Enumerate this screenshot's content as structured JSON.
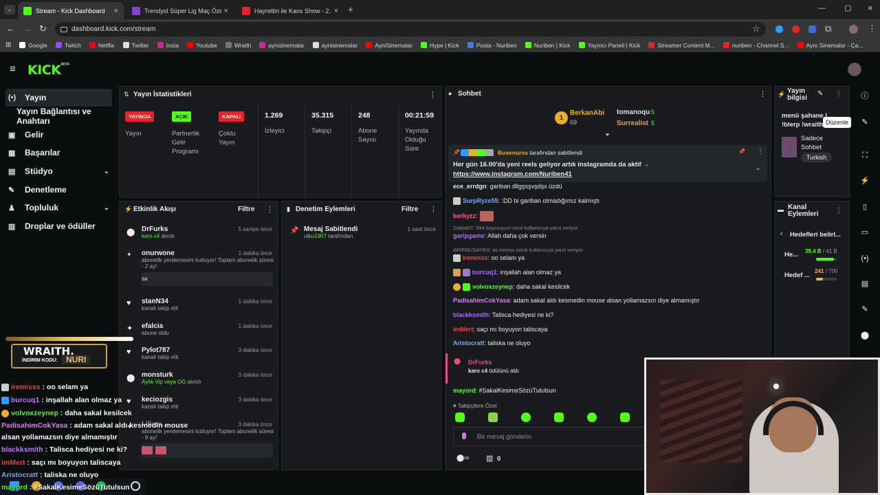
{
  "colors": {
    "kick_green": "#53fc18",
    "panel_bg": "#191b1f",
    "page_bg": "#0b0e0f",
    "red_badge": "#e4262c",
    "purple": "#b26bff"
  },
  "browser": {
    "tabs": [
      {
        "title": "Stream - Kick Dashboard",
        "icon": "kick-icon"
      },
      {
        "title": "Trendyol Süper Lig Maç Özetleri",
        "icon": "youtube-icon"
      },
      {
        "title": "Hayrettin ile Kaos Show - 2.Sez...",
        "icon": "youtube-icon"
      }
    ],
    "url": "dashboard.kick.com/stream",
    "bookmarks": [
      "Google",
      "Twitch",
      "Netflix",
      "Twitter",
      "Insta",
      "Youtube",
      "Wraith",
      "aynisinemalar",
      "aynisinemalar",
      "AyniSinemalar",
      "Hype | Kick",
      "Posta - Nuriben",
      "Nuriben | Kick",
      "Yayıncı Paneli | Kick",
      "Streamer Content M...",
      "nuriben - Channel S...",
      "Aynı Sinemalar - Ça..."
    ]
  },
  "logo": {
    "text": "KICK",
    "sup": "BETA"
  },
  "sidebar": {
    "items": [
      {
        "label": "Yayın",
        "icon": "broadcast-icon"
      },
      {
        "label": "Yayın Bağlantısı ve Anahtarı",
        "icon": ""
      },
      {
        "label": "Gelir",
        "icon": "dollar-icon"
      },
      {
        "label": "Başarılar",
        "icon": "trophy-icon"
      },
      {
        "label": "Stüdyo",
        "icon": "studio-icon"
      },
      {
        "label": "Denetleme",
        "icon": "wrench-icon"
      },
      {
        "label": "Topluluk",
        "icon": "users-icon"
      },
      {
        "label": "Droplar ve ödüller",
        "icon": "gift-icon"
      }
    ]
  },
  "stats": {
    "title": "Yayın İstatistikleri",
    "badges": [
      {
        "badge": "YAYINDA",
        "label": "Yayın"
      },
      {
        "badge": "AÇIK",
        "label": "Partnerlik Gelir Programı"
      },
      {
        "badge": "KAPALI",
        "label": "Çoklu Yayın"
      }
    ],
    "values": [
      {
        "value": "1.269",
        "label": "İzleyici"
      },
      {
        "value": "35.315",
        "label": "Takipçi"
      },
      {
        "value": "248",
        "label": "Abone Sayısı"
      },
      {
        "value": "00:21:59",
        "label": "Yayında Olduğu Süre"
      }
    ]
  },
  "activity": {
    "title": "Etkinlik Akışı",
    "filter": "Filtre",
    "events": [
      {
        "name": "DrFurks",
        "sub": "karo c4",
        "sub_suffix": " alındı",
        "time": "5 saniye önce",
        "icon": "drop-icon"
      },
      {
        "name": "onurwone",
        "sub": "abonelik yenilemesini kutluyor! Toplam abonelik süresi - 2 ay!",
        "time": "1 dakika önce",
        "message": "sa",
        "icon": "star-icon"
      },
      {
        "name": "stanN34",
        "sub": "kanalı takip etti",
        "time": "1 dakika önce",
        "icon": "heart-icon"
      },
      {
        "name": "efalcia",
        "sub": "abone oldu",
        "time": "1 dakika önce",
        "icon": "star-icon"
      },
      {
        "name": "Pylot787",
        "sub": "kanalı takip etti",
        "time": "3 dakika önce",
        "icon": "heart-icon"
      },
      {
        "name": "monsturk",
        "sub": "Aylık Vip veya OG",
        "sub_suffix": " alındı",
        "time": "3 dakika önce",
        "icon": "drop-icon"
      },
      {
        "name": "keciozgis",
        "sub": "kanalı takip etti",
        "time": "3 dakika önce",
        "icon": "heart-icon"
      },
      {
        "name": "Lilium...",
        "sub": "abonelik yenilemesini kutluyor! Toplam abonelik süresi - 9 ay!",
        "time": "3 dakika önce",
        "icon": "star-icon"
      }
    ]
  },
  "moderation": {
    "title": "Denetim Eylemleri",
    "filter": "Filtre",
    "event": {
      "name": "Mesaj Sabitlendi",
      "by": "utku1907",
      "by_suffix": " tarafından",
      "time": "1 saat önce"
    }
  },
  "chat": {
    "title": "Sohbet",
    "top_chatters": [
      {
        "name": "BerkanAbi",
        "count": "69"
      },
      {
        "name": "tomanoqu",
        "count": "5"
      },
      {
        "name": "Surrealist",
        "count": "5"
      }
    ],
    "pinned": {
      "by": "Busenurss",
      "by_suffix": " tarafından sabitlendi",
      "text": "Her gün 16.00'da yeni reels geliyor artık instagramda da aktif →",
      "link": "https://www.instagram.com/Nuriben41"
    },
    "messages": [
      {
        "user": "ece_errdgn",
        "color": "#e0e0e0",
        "text": ": gariban dllgşsşvşdşx üzdü"
      },
      {
        "user": "SurpRyze55",
        "color": "#7aa7ff",
        "text": ": :DD bi gariban olmadığımız kalmıştı"
      },
      {
        "user": "berkyzz",
        "color": "#ff5a8a",
        "text": ":"
      },
      {
        "reply": "Zaldot07: 994 koymuşum ismil kullanıcıya yanıt veriyor",
        "user": "garipgame",
        "color": "#b26bff",
        "text": ": Allah daha çok versin"
      },
      {
        "reply": "ARIFMUSAYEV: as iremsu isimli kullanıcıya yanıt veriyor",
        "user": "iremisss",
        "color": "#ff3b3b",
        "text": ": oo selam ya"
      },
      {
        "user": "burcuq1",
        "color": "#b26bff",
        "text": ": inşallah alan olmaz ya"
      },
      {
        "user": "volvoxzeynep",
        "color": "#53fc18",
        "text": ": daha sakal kesilcek"
      },
      {
        "user": "PadisahimCokYasa",
        "color": "#e07bff",
        "text": ": adam sakal aldı kesmedin mouse alsan yollamazsın diye almamıştır"
      },
      {
        "user": "blackksmith",
        "color": "#b26bff",
        "text": ": Talisca hediyesi ne ki?"
      },
      {
        "user": "imMert",
        "color": "#ff3b3b",
        "text": ": saçı mı boyuyon taliscaya"
      },
      {
        "user": "Aristocratt",
        "color": "#7aa7ff",
        "text": ": taliska ne oluyo"
      }
    ],
    "drop": {
      "name": "DrFurks",
      "item": "karo c4",
      "suffix": " ödülünü aldı"
    },
    "last": {
      "user": "mayord",
      "text": ": #SakalKesimeSözüTutulsun"
    },
    "followers_only": "Takipçilere Özel",
    "input_placeholder": "Bir mesaj gönderin",
    "footer_count": "0"
  },
  "stream_info": {
    "title": "Yayın bilgisi",
    "title_text": "menü şahane | !blerp !wraith",
    "tooltip": "Düzenle",
    "category": "Sadece Sohbet",
    "tag": "Turkish"
  },
  "channel_actions": {
    "title": "Kanal Eylemleri",
    "goals": "Hedefleri belirl...",
    "rows": [
      {
        "label": "He...",
        "value": "35,4 B",
        "total": " / 41 B",
        "progress": 0.86,
        "color": "#53fc18"
      },
      {
        "label": "Hedef ...",
        "value": "241",
        "total": " / 700",
        "progress": 0.34,
        "color": "#f0b45a"
      }
    ]
  },
  "overlay": {
    "promo_title": "WRAITH.",
    "promo_code_label": "İNDİRİM KODU:",
    "promo_code": "NURI",
    "chat": [
      {
        "user": "iremisss",
        "color": "#ff3b3b",
        "text": " : oo selam ya"
      },
      {
        "user": "burcuq1",
        "color": "#c07bff",
        "text": " : inşallah alan olmaz ya"
      },
      {
        "user": "volvoxzeynep",
        "color": "#53fc18",
        "text": " : daha sakal kesilcek"
      },
      {
        "user": "PadisahimCokYasa",
        "color": "#e07bff",
        "text": " : adam sakal aldı kesmedin mouse"
      },
      {
        "user": "",
        "color": "#fff",
        "text": "alsan yollamazsın diye almamıştır"
      },
      {
        "user": "blackksmith",
        "color": "#c07bff",
        "text": " : Talisca hediyesi ne ki?"
      },
      {
        "user": "imMert",
        "color": "#ff3b3b",
        "text": " : saçı mı boyuyon taliscaya"
      },
      {
        "user": "Aristocratt",
        "color": "#7aa7ff",
        "text": " : taliska ne oluyo"
      },
      {
        "user": "mayord",
        "color": "#53fc18",
        "text": " : #SakalKesimeSözüTutulsun"
      }
    ]
  }
}
